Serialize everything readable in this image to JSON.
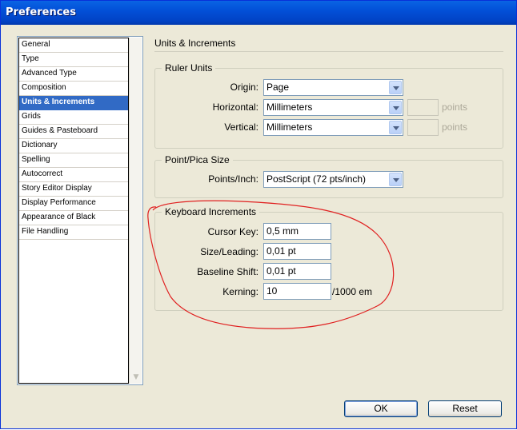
{
  "window": {
    "title": "Preferences"
  },
  "categories": [
    "General",
    "Type",
    "Advanced Type",
    "Composition",
    "Units & Increments",
    "Grids",
    "Guides & Pasteboard",
    "Dictionary",
    "Spelling",
    "Autocorrect",
    "Story Editor Display",
    "Display Performance",
    "Appearance of Black",
    "File Handling"
  ],
  "selected_category": "Units & Increments",
  "section_title": "Units & Increments",
  "ruler_units": {
    "group_label": "Ruler Units",
    "origin_label": "Origin:",
    "origin_value": "Page",
    "horizontal_label": "Horizontal:",
    "horizontal_value": "Millimeters",
    "horizontal_points_label": "points",
    "vertical_label": "Vertical:",
    "vertical_value": "Millimeters",
    "vertical_points_label": "points"
  },
  "point_pica": {
    "group_label": "Point/Pica Size",
    "points_per_inch_label": "Points/Inch:",
    "points_per_inch_value": "PostScript (72 pts/inch)"
  },
  "keyboard_increments": {
    "group_label": "Keyboard Increments",
    "cursor_key_label": "Cursor Key:",
    "cursor_key_value": "0,5 mm",
    "size_leading_label": "Size/Leading:",
    "size_leading_value": "0,01 pt",
    "baseline_shift_label": "Baseline Shift:",
    "baseline_shift_value": "0,01 pt",
    "kerning_label": "Kerning:",
    "kerning_value": "10",
    "kerning_suffix": "/1000 em"
  },
  "buttons": {
    "ok": "OK",
    "reset": "Reset"
  },
  "colors": {
    "annotation": "#E02020",
    "selection": "#316AC5",
    "titlebar": "#0A5DE0"
  }
}
